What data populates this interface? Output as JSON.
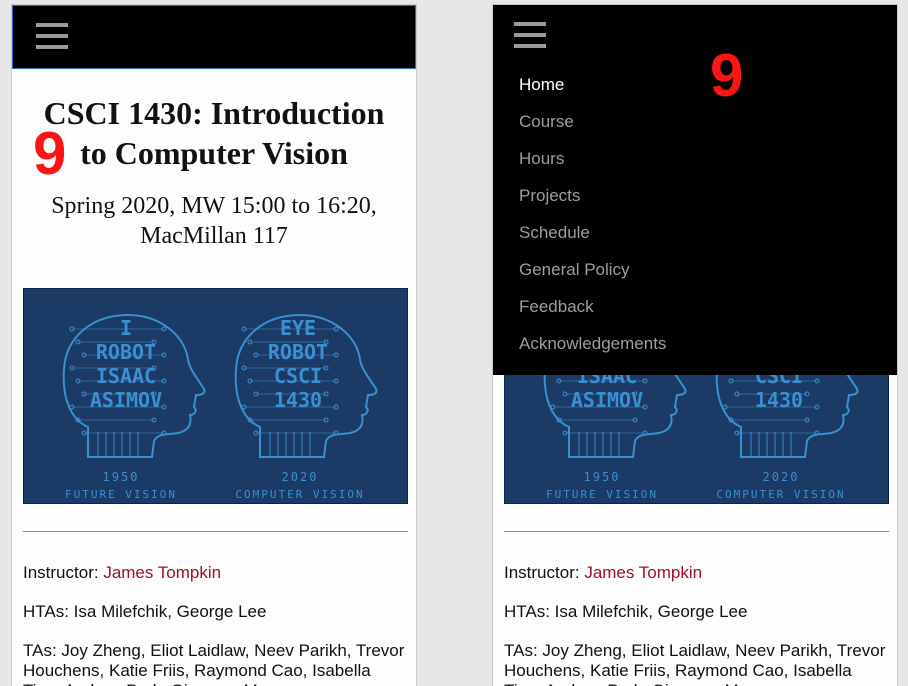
{
  "page": {
    "title": "CSCI 1430: Introduction to Computer Vision",
    "subtitle": "Spring 2020, MW 15:00 to 16:20, MacMillan 117",
    "step_badge": "9"
  },
  "banner": {
    "left_head_words": [
      "I",
      "ROBOT",
      "ISAAC",
      "ASIMOV"
    ],
    "right_head_words": [
      "EYE",
      "ROBOT",
      "CSCI",
      "1430"
    ],
    "left_year": "1950",
    "left_caption": "FUTURE VISION",
    "right_year": "2020",
    "right_caption": "COMPUTER VISION",
    "colors": {
      "background": "#1b3a66",
      "circuit": "#3c8fd0"
    }
  },
  "staff": {
    "instructor_label": "Instructor: ",
    "instructor_name": "James Tompkin",
    "htas_line": "HTAs: Isa Milefchik, George Lee",
    "tas_line": "TAs: Joy Zheng, Eliot Laidlaw, Neev Parikh, Trevor Houchens, Katie Friis, Raymond Cao, Isabella Tien, Andrew Park, Giacomo Marcon"
  },
  "nav": {
    "items": [
      {
        "label": "Home",
        "active": true
      },
      {
        "label": "Course",
        "active": false
      },
      {
        "label": "Hours",
        "active": false
      },
      {
        "label": "Projects",
        "active": false
      },
      {
        "label": "Schedule",
        "active": false
      },
      {
        "label": "General Policy",
        "active": false
      },
      {
        "label": "Feedback",
        "active": false
      },
      {
        "label": "Acknowledgements",
        "active": false
      }
    ]
  },
  "icons": {
    "menu": "hamburger-menu-icon"
  },
  "colors": {
    "topbar": "#000000",
    "link": "#a01123",
    "badge": "#ff1414",
    "nav_active": "#ffffff",
    "nav_inactive": "#9d9d9d"
  }
}
